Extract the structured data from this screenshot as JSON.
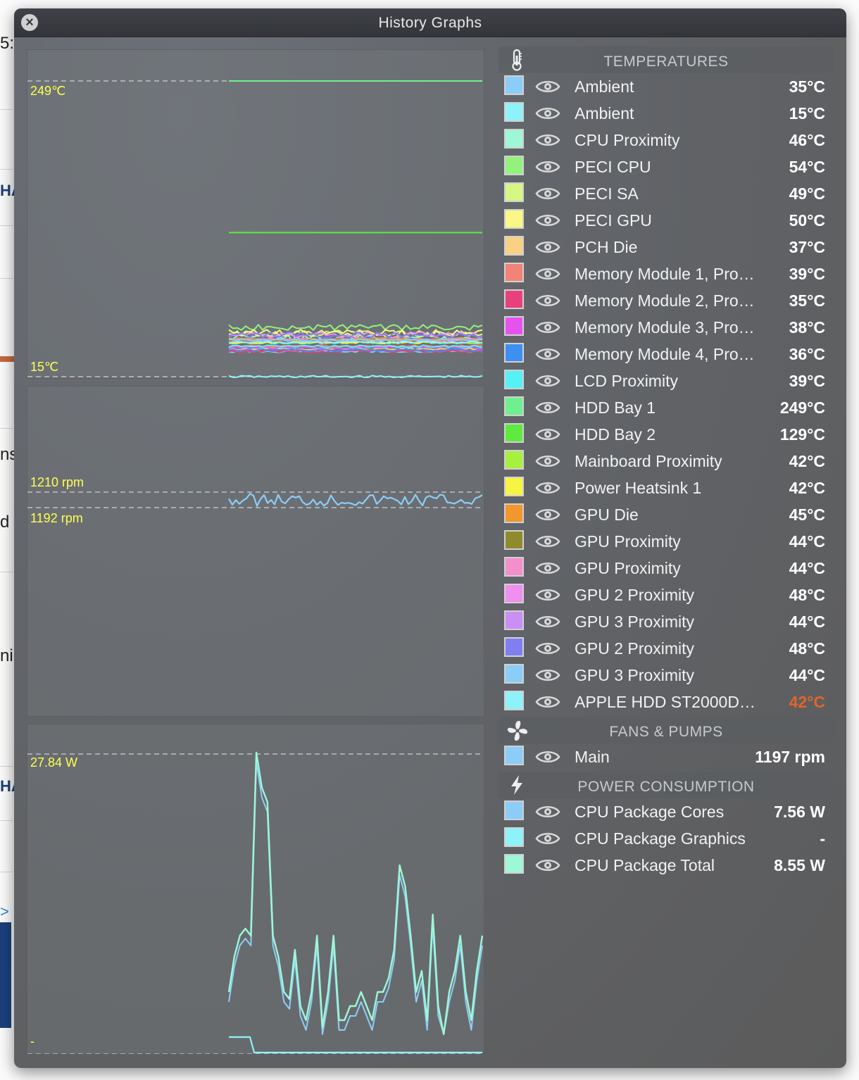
{
  "window": {
    "title": "History Graphs"
  },
  "background_fragments": [
    "5:",
    "HA",
    "ns",
    "d",
    "ni",
    "HA",
    ">"
  ],
  "graphs": {
    "temperature": {
      "max_label": "249℃",
      "min_label": "15℃"
    },
    "fans": {
      "max_label": "1210 rpm",
      "min_label": "1192 rpm"
    },
    "power": {
      "max_label": "27.84  W",
      "min_label": "-"
    }
  },
  "sections": {
    "temperatures": {
      "title": "TEMPERATURES",
      "icon": "thermometer-icon",
      "sensors": [
        {
          "name": "Ambient",
          "value": "35°C",
          "color": "#8ccdf8"
        },
        {
          "name": "Ambient",
          "value": "15°C",
          "color": "#8ef2fa"
        },
        {
          "name": "CPU Proximity",
          "value": "46°C",
          "color": "#9ef7d6"
        },
        {
          "name": "PECI CPU",
          "value": "54°C",
          "color": "#92f27c"
        },
        {
          "name": "PECI SA",
          "value": "49°C",
          "color": "#d6f784"
        },
        {
          "name": "PECI GPU",
          "value": "50°C",
          "color": "#fbf784"
        },
        {
          "name": "PCH Die",
          "value": "37°C",
          "color": "#f9d184"
        },
        {
          "name": "Memory Module 1, Pro…",
          "value": "39°C",
          "color": "#f28376"
        },
        {
          "name": "Memory Module 2, Pro…",
          "value": "35°C",
          "color": "#e8407c"
        },
        {
          "name": "Memory Module 3, Pro…",
          "value": "38°C",
          "color": "#e553ef"
        },
        {
          "name": "Memory Module 4, Pro…",
          "value": "36°C",
          "color": "#3d8ff2"
        },
        {
          "name": "LCD Proximity",
          "value": "39°C",
          "color": "#56f1f6"
        },
        {
          "name": "HDD Bay 1",
          "value": "249°C",
          "color": "#6ff08e"
        },
        {
          "name": "HDD Bay 2",
          "value": "129°C",
          "color": "#5eea3e"
        },
        {
          "name": "Mainboard Proximity",
          "value": "42°C",
          "color": "#a8f040"
        },
        {
          "name": "Power Heatsink 1",
          "value": "42°C",
          "color": "#f8f542"
        },
        {
          "name": "GPU Die",
          "value": "45°C",
          "color": "#f2962e"
        },
        {
          "name": "GPU Proximity",
          "value": "44°C",
          "color": "#8f8a2c"
        },
        {
          "name": "GPU Proximity",
          "value": "44°C",
          "color": "#f48fcd"
        },
        {
          "name": "GPU 2 Proximity",
          "value": "48°C",
          "color": "#ef8ff0"
        },
        {
          "name": "GPU 3 Proximity",
          "value": "44°C",
          "color": "#c98ff2"
        },
        {
          "name": "GPU 2 Proximity",
          "value": "48°C",
          "color": "#7f7ff2"
        },
        {
          "name": "GPU 3 Proximity",
          "value": "44°C",
          "color": "#8ccdf8"
        },
        {
          "name": "APPLE HDD ST2000D…",
          "value": "42°C",
          "color": "#8ef2fa",
          "value_color": "#e0642c"
        }
      ]
    },
    "fans": {
      "title": "FANS & PUMPS",
      "icon": "fan-icon",
      "sensors": [
        {
          "name": "Main",
          "value": "1197 rpm",
          "color": "#8ccdf8"
        }
      ]
    },
    "power": {
      "title": "POWER CONSUMPTION",
      "icon": "lightning-icon",
      "sensors": [
        {
          "name": "CPU Package Cores",
          "value": "7.56 W",
          "color": "#8ccdf8"
        },
        {
          "name": "CPU Package Graphics",
          "value": "-",
          "color": "#8ef2fa"
        },
        {
          "name": "CPU Package Total",
          "value": "8.55 W",
          "color": "#9ef7d6"
        }
      ]
    }
  }
}
